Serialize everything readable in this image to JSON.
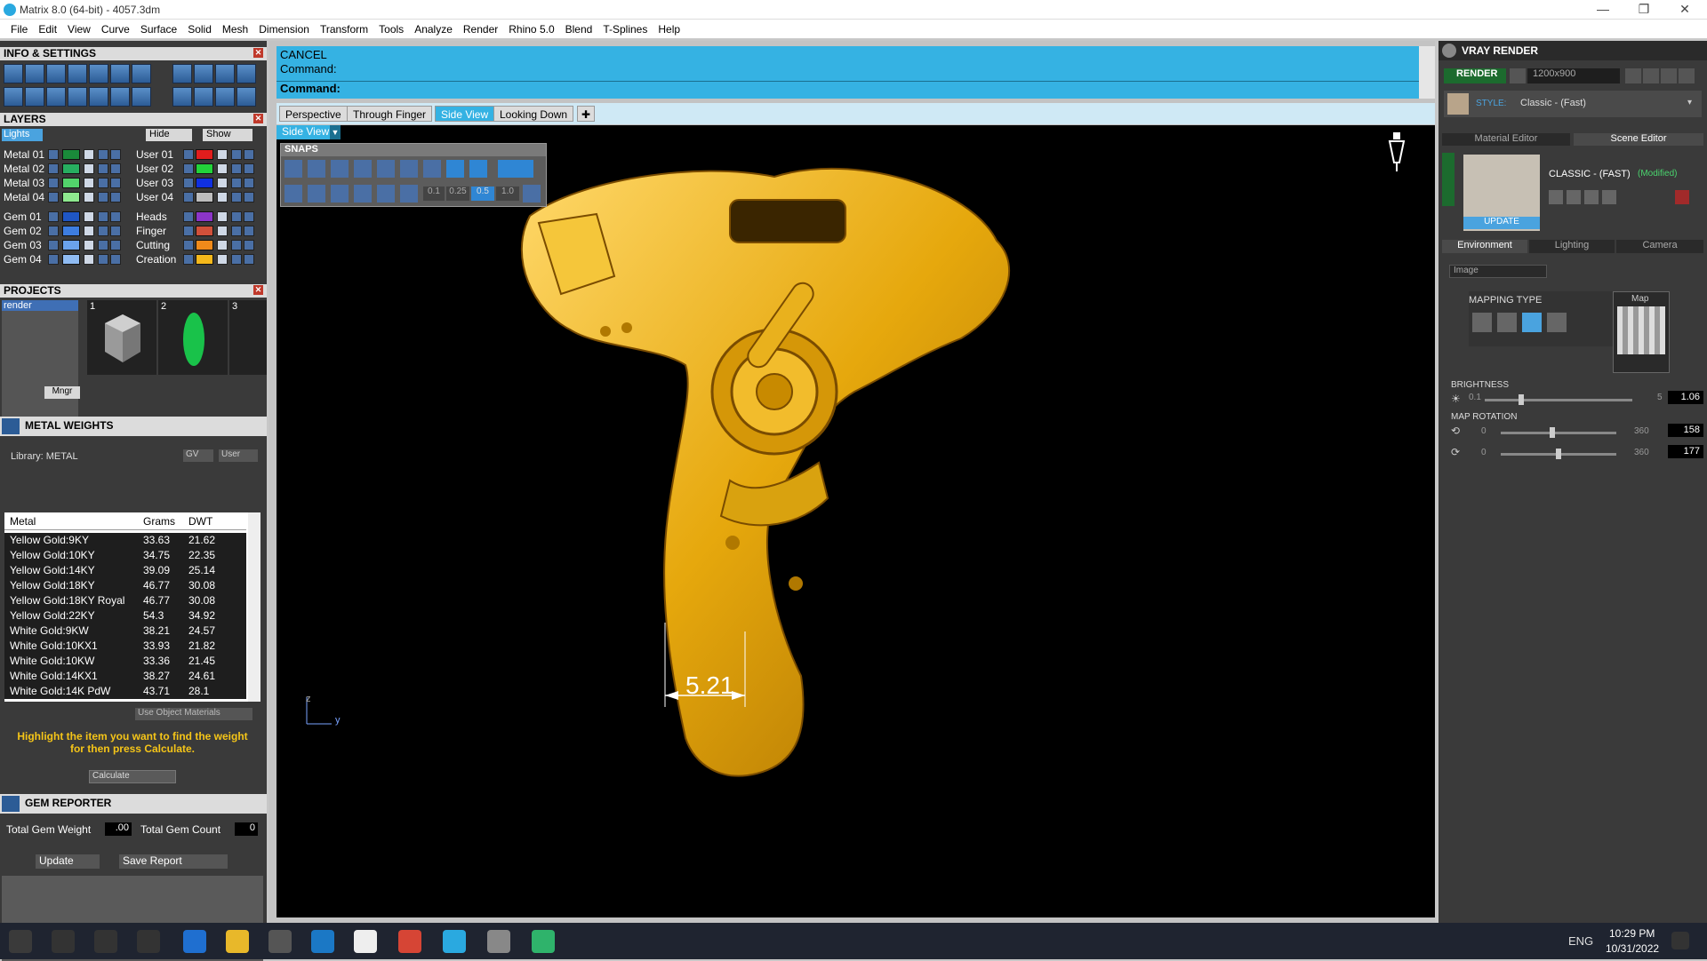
{
  "window": {
    "title": "Matrix 8.0 (64-bit) - 4057.3dm",
    "min": "—",
    "max": "❐",
    "close": "✕"
  },
  "menu": [
    "File",
    "Edit",
    "View",
    "Curve",
    "Surface",
    "Solid",
    "Mesh",
    "Dimension",
    "Transform",
    "Tools",
    "Analyze",
    "Render",
    "Rhino 5.0",
    "Blend",
    "T-Splines",
    "Help"
  ],
  "info_settings": {
    "title": "INFO & SETTINGS"
  },
  "layers": {
    "title": "LAYERS",
    "selected": "Lights",
    "hide_label": "Hide",
    "show_label": "Show",
    "left": [
      {
        "name": "Metal 01",
        "color": "#1a8a3a"
      },
      {
        "name": "Metal 02",
        "color": "#27ae60"
      },
      {
        "name": "Metal 03",
        "color": "#52d36b"
      },
      {
        "name": "Metal 04",
        "color": "#8ee88f"
      },
      {
        "name": "Gem 01",
        "color": "#1f56c4"
      },
      {
        "name": "Gem 02",
        "color": "#3d7de0"
      },
      {
        "name": "Gem 03",
        "color": "#6aa2ec"
      },
      {
        "name": "Gem 04",
        "color": "#8fbbf2"
      }
    ],
    "right": [
      {
        "name": "User 01",
        "color": "#e11d1d"
      },
      {
        "name": "User 02",
        "color": "#22d33a"
      },
      {
        "name": "User 03",
        "color": "#1030e0"
      },
      {
        "name": "User 04",
        "color": "#bdbdbd"
      },
      {
        "name": "Heads",
        "color": "#8b35c8"
      },
      {
        "name": "Finger",
        "color": "#d0503a"
      },
      {
        "name": "Cutting",
        "color": "#f08a1a"
      },
      {
        "name": "Creation",
        "color": "#f5b81b"
      }
    ]
  },
  "projects": {
    "title": "PROJECTS",
    "item": "render",
    "thumbs": [
      "1",
      "2",
      "3"
    ],
    "mngr": "Mngr"
  },
  "metal_weights": {
    "title": "METAL WEIGHTS",
    "library": "Library: METAL",
    "gv": "GV",
    "user": "User",
    "columns": [
      "Metal",
      "Grams",
      "DWT"
    ],
    "rows": [
      [
        "Yellow Gold:9KY",
        "33.63",
        "21.62"
      ],
      [
        "Yellow Gold:10KY",
        "34.75",
        "22.35"
      ],
      [
        "Yellow Gold:14KY",
        "39.09",
        "25.14"
      ],
      [
        "Yellow Gold:18KY",
        "46.77",
        "30.08"
      ],
      [
        "Yellow Gold:18KY Royal",
        "46.77",
        "30.08"
      ],
      [
        "Yellow Gold:22KY",
        "54.3",
        "34.92"
      ],
      [
        "White Gold:9KW",
        "38.21",
        "24.57"
      ],
      [
        "White Gold:10KX1",
        "33.93",
        "21.82"
      ],
      [
        "White Gold:10KW",
        "33.36",
        "21.45"
      ],
      [
        "White Gold:14KX1",
        "38.27",
        "24.61"
      ],
      [
        "White Gold:14K PdW",
        "43.71",
        "28.1"
      ]
    ],
    "use_object_materials": "Use Object Materials",
    "hint": "Highlight the item you want to find the weight for then press Calculate.",
    "calculate": "Calculate"
  },
  "gem_reporter": {
    "title": "GEM REPORTER",
    "total_weight_label": "Total Gem Weight",
    "total_weight": ".00",
    "total_count_label": "Total Gem Count",
    "total_count": "0",
    "update": "Update",
    "save_report": "Save Report"
  },
  "command": {
    "line1": "CANCEL",
    "line2": "Command:",
    "prompt": "Command:"
  },
  "view_tabs": [
    "Perspective",
    "Through Finger",
    "Side View",
    "Looking Down"
  ],
  "active_tab": "Side View",
  "viewport": {
    "label": "Side View",
    "dimension": "5.21",
    "axis_z": "z",
    "axis_y": "y"
  },
  "snaps": {
    "title": "SNAPS",
    "values": [
      "0.1",
      "0.25",
      "0.5",
      "1.0"
    ]
  },
  "vray": {
    "title": "VRAY RENDER",
    "render_btn": "RENDER",
    "resolution": "1200x900",
    "style_label": "STYLE:",
    "style_value": "Classic - (Fast)",
    "tabs": [
      "Material Editor",
      "Scene Editor"
    ],
    "scene_name": "CLASSIC - (FAST)",
    "scene_mod": "(Modified)",
    "update": "UPDATE",
    "env_tabs": [
      "Environment",
      "Lighting",
      "Camera"
    ],
    "env_type": "Image",
    "mapping_type": "MAPPING TYPE",
    "map_label": "Map",
    "brightness_label": "BRIGHTNESS",
    "brightness_min": "0.1",
    "brightness_max": "5",
    "brightness_value": "1.06",
    "map_rotation_label": "MAP ROTATION",
    "rot1_min": "0",
    "rot1_max": "360",
    "rot1_value": "158",
    "rot2_min": "0",
    "rot2_max": "360",
    "rot2_value": "177"
  },
  "taskbar": {
    "lang": "ENG",
    "time": "10:29 PM",
    "date": "10/31/2022"
  }
}
